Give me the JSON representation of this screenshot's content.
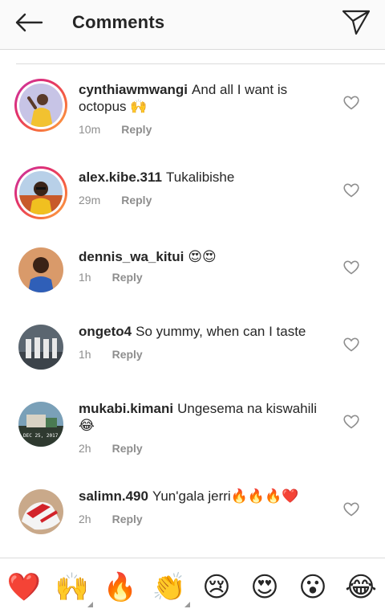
{
  "header": {
    "title": "Comments",
    "back_icon": "back-arrow-icon",
    "send_icon": "send-icon"
  },
  "comments": [
    {
      "username": "cynthiawmwangi",
      "text": "And all I want is octopus 🙌",
      "time": "10m",
      "reply": "Reply",
      "avatar_story": true
    },
    {
      "username": "alex.kibe.311",
      "text": "Tukalibishe",
      "time": "29m",
      "reply": "Reply",
      "avatar_story": true
    },
    {
      "username": "dennis_wa_kitui",
      "text": "😍😍",
      "time": "1h",
      "reply": "Reply",
      "avatar_story": false
    },
    {
      "username": "ongeto4",
      "text": "So yummy, when can I taste",
      "time": "1h",
      "reply": "Reply",
      "avatar_story": false
    },
    {
      "username": "mukabi.kimani",
      "text": "Ungesema na kiswahili 😂",
      "time": "2h",
      "reply": "Reply",
      "avatar_story": false,
      "avatar_caption": "DEC 25, 2017"
    },
    {
      "username": "salimn.490",
      "text": "Yun'gala jerri🔥🔥🔥❤️",
      "time": "2h",
      "reply": "Reply",
      "avatar_story": false
    }
  ],
  "emoji_bar": [
    "❤️",
    "🙌",
    "🔥",
    "👏",
    "😢",
    "😍",
    "😮",
    "😂"
  ],
  "colors": {
    "text": "#262626",
    "secondary": "#8e8e8e",
    "divider": "#dbdbdb",
    "header_bg": "#fafafa"
  }
}
